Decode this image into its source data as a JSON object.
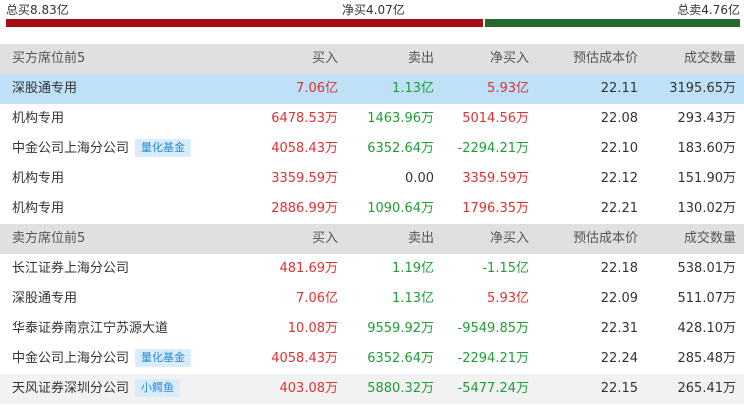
{
  "summary": {
    "buy_total": "总买8.83亿",
    "net_total": "净买4.07亿",
    "sell_total": "总卖4.76亿",
    "buy_ratio": 0.65,
    "colors": {
      "buy": "#a80d17",
      "sell": "#27692c"
    }
  },
  "buy_section": {
    "header": {
      "name": "买方席位前5",
      "buy": "买入",
      "sell": "卖出",
      "net": "净买入",
      "cost": "预估成本价",
      "vol": "成交数量"
    },
    "rows": [
      {
        "name": "深股通专用",
        "tag": "",
        "buy": "7.06亿",
        "sell": "1.13亿",
        "net": "5.93亿",
        "cost": "22.11",
        "vol": "3195.65万"
      },
      {
        "name": "机构专用",
        "tag": "",
        "buy": "6478.53万",
        "sell": "1463.96万",
        "net": "5014.56万",
        "cost": "22.08",
        "vol": "293.43万"
      },
      {
        "name": "中金公司上海分公司",
        "tag": "量化基金",
        "buy": "4058.43万",
        "sell": "6352.64万",
        "net": "-2294.21万",
        "cost": "22.10",
        "vol": "183.60万"
      },
      {
        "name": "机构专用",
        "tag": "",
        "buy": "3359.59万",
        "sell": "0.00",
        "net": "3359.59万",
        "cost": "22.12",
        "vol": "151.90万"
      },
      {
        "name": "机构专用",
        "tag": "",
        "buy": "2886.99万",
        "sell": "1090.64万",
        "net": "1796.35万",
        "cost": "22.21",
        "vol": "130.02万"
      }
    ]
  },
  "sell_section": {
    "header": {
      "name": "卖方席位前5",
      "buy": "买入",
      "sell": "卖出",
      "net": "净买入",
      "cost": "预估成本价",
      "vol": "成交数量"
    },
    "rows": [
      {
        "name": "长江证券上海分公司",
        "tag": "",
        "buy": "481.69万",
        "sell": "1.19亿",
        "net": "-1.15亿",
        "cost": "22.18",
        "vol": "538.01万"
      },
      {
        "name": "深股通专用",
        "tag": "",
        "buy": "7.06亿",
        "sell": "1.13亿",
        "net": "5.93亿",
        "cost": "22.09",
        "vol": "511.07万"
      },
      {
        "name": "华泰证券南京江宁苏源大道",
        "tag": "",
        "buy": "10.08万",
        "sell": "9559.92万",
        "net": "-9549.85万",
        "cost": "22.31",
        "vol": "428.10万"
      },
      {
        "name": "中金公司上海分公司",
        "tag": "量化基金",
        "buy": "4058.43万",
        "sell": "6352.64万",
        "net": "-2294.21万",
        "cost": "22.24",
        "vol": "285.48万"
      },
      {
        "name": "天风证券深圳分公司",
        "tag": "小鳄鱼",
        "buy": "403.08万",
        "sell": "5880.32万",
        "net": "-5477.24万",
        "cost": "22.15",
        "vol": "265.41万"
      }
    ]
  }
}
